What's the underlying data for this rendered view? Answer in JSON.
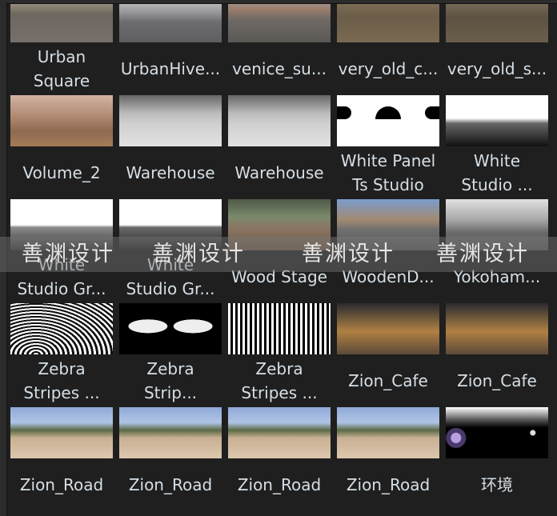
{
  "items": [
    {
      "label": "Urban\nSquare",
      "thumb": "linear-gradient(#b9c6d2 0%,#8a8272 30%,#6e6760 45%,#77706a 100%)"
    },
    {
      "label": "UrbanHive...",
      "thumb": "linear-gradient(#ddd 0%,#9a9a9c 40%,#6d6d70 60%,#5e5e60 100%)"
    },
    {
      "label": "venice_su...",
      "thumb": "linear-gradient(#a7b8d0 0%,#9b7d6a 35%,#6f6a66 55%,#5b5855 100%)"
    },
    {
      "label": "very_old_c...",
      "thumb": "linear-gradient(#8c7a60 0%,#6c5d49 50%,#7a6a53 100%)"
    },
    {
      "label": "very_old_s...",
      "thumb": "linear-gradient(#8d8068 0%,#5d5243 50%,#6a5e4b 100%)"
    },
    {
      "label": "Volume_2",
      "thumb": "linear-gradient(#d2b3a2 0%,#b28b74 40%,#8e6a51 70%,#a57c57 100%)"
    },
    {
      "label": "Warehouse",
      "thumb": "linear-gradient(#666 0%,#bbb 35%,#cfcfcf 55%,#e2e2e2 100%)"
    },
    {
      "label": "Warehouse",
      "thumb": "linear-gradient(#666 0%,#bbb 35%,#cfcfcf 55%,#e2e2e2 100%)"
    },
    {
      "label": "White Panel\nTs Studio",
      "thumb": "radial-gradient(ellipse at 50% 30%,#fff 40%,#fff 100%),#fff",
      "extra": "panel"
    },
    {
      "label": "White\nStudio ...",
      "thumb": "linear-gradient(#fff 0%,#fff 45%,#666 55%,#111 100%)"
    },
    {
      "label": "White\nStudio Gr...",
      "thumb": "linear-gradient(#fff 0%,#fff 50%,#8a8a8a 55%,#333 100%)"
    },
    {
      "label": "White\nStudio Gr...",
      "thumb": "linear-gradient(#fff 0%,#fff 50%,#6a6a6a 55%,#222 100%)"
    },
    {
      "label": "Wood Stage",
      "thumb": "linear-gradient(#4f5a48 0%,#7a8a6a 35%,#8b7663 55%,#6e5a4a 100%)"
    },
    {
      "label": "WoodenD...",
      "thumb": "linear-gradient(#7a9ccc 0%,#a28a72 40%,#6f6f6f 60%,#555 100%)"
    },
    {
      "label": "Yokoham...",
      "thumb": "linear-gradient(#e0e0e0 0%,#a8a8a8 40%,#6a6a6a 65%,#555 100%)"
    },
    {
      "label": "Zebra\nStripes ...",
      "thumb": "repeating-radial-gradient(ellipse at 25% 100%,#fff 0 3px,#111 3px 6px)"
    },
    {
      "label": "Zebra\nStrip...",
      "thumb": "radial-gradient(ellipse 40px 14px at 28% 45%,#eee 60%,transparent 62%),radial-gradient(ellipse 40px 14px at 72% 45%,#eee 60%,transparent 62%),#000"
    },
    {
      "label": "Zebra\nStripes ...",
      "thumb": "repeating-linear-gradient(90deg,#fff 0 3px,#000 3px 6px)"
    },
    {
      "label": "Zion_Cafe",
      "thumb": "linear-gradient(#2b2a30 0%,#8a6a3e 40%,#b08042 55%,#5b4a3a 100%)"
    },
    {
      "label": "Zion_Cafe",
      "thumb": "linear-gradient(#2b2a30 0%,#8a6a3e 40%,#b08042 55%,#5b4a3a 100%)"
    },
    {
      "label": "Zion_Road",
      "thumb": "linear-gradient(#8fa9d6 0%,#b0c4e6 30%,#5a6a44 45%,#c9b094 60%,#dcc7ad 100%)"
    },
    {
      "label": "Zion_Road",
      "thumb": "linear-gradient(#8fa9d6 0%,#b0c4e6 30%,#5a6a44 45%,#c9b094 60%,#dcc7ad 100%)"
    },
    {
      "label": "Zion_Road",
      "thumb": "linear-gradient(#8fa9d6 0%,#b0c4e6 30%,#5a6a44 45%,#c9b094 60%,#dcc7ad 100%)"
    },
    {
      "label": "Zion_Road",
      "thumb": "linear-gradient(#8fa9d6 0%,#b0c4e6 30%,#5a6a44 45%,#c9b094 60%,#dcc7ad 100%)"
    },
    {
      "label": "环境",
      "thumb": "radial-gradient(circle at 10% 60%,#b9a0e0 0 6px,#4a3a6a 7px 12px,transparent 13px),radial-gradient(circle at 85% 50%,#ddd 0 3px,transparent 4px),linear-gradient(#fff 0%,#555 25%,#000 40%,#000 100%)"
    }
  ],
  "watermark": {
    "text": "善渊设计"
  }
}
